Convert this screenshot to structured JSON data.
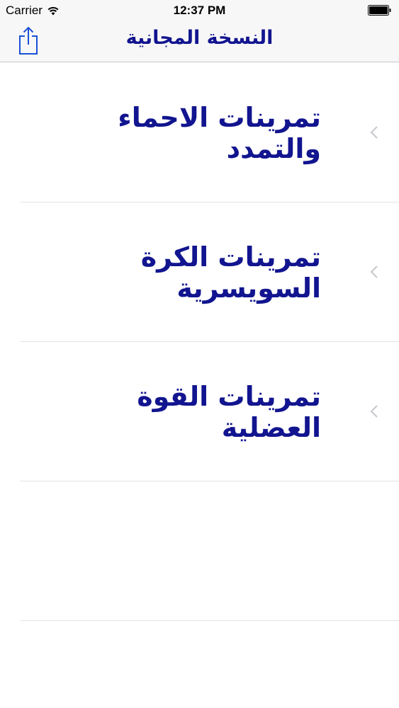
{
  "status_bar": {
    "carrier": "Carrier",
    "time": "12:37 PM"
  },
  "nav": {
    "title": "النسخة المجانية",
    "share_icon": "share-icon"
  },
  "list": {
    "items": [
      {
        "label": "تمرينات الاحماء والتمدد"
      },
      {
        "label": "تمرينات الكرة السويسرية"
      },
      {
        "label": "تمرينات القوة العضلية"
      },
      {
        "label": ""
      }
    ]
  },
  "colors": {
    "accent": "#12158f",
    "nav_bg": "#f7f7f7",
    "separator": "#e3e3e6",
    "chevron": "#c7c7cc"
  }
}
